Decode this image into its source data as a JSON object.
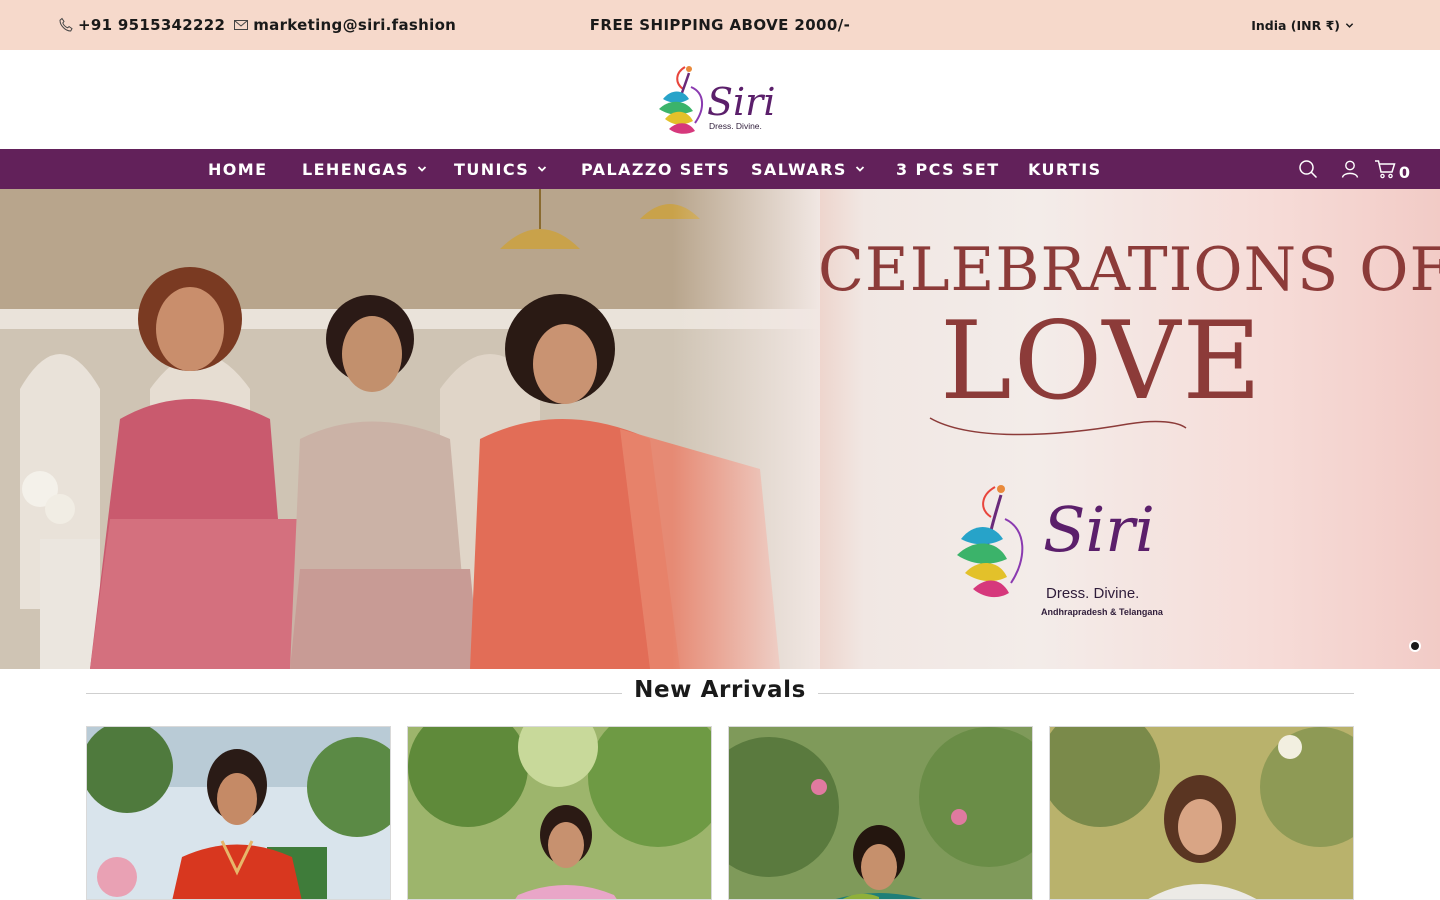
{
  "topbar": {
    "phone": "+91 9515342222",
    "email": "marketing@siri.fashion",
    "promo": "FREE SHIPPING ABOVE 2000/-",
    "currency": "India (INR ₹)"
  },
  "logo": {
    "brand": "Siri",
    "tagline": "Dress. Divine."
  },
  "nav": {
    "items": [
      {
        "label": "HOME",
        "has_dropdown": false
      },
      {
        "label": "LEHENGAS",
        "has_dropdown": true
      },
      {
        "label": "TUNICS",
        "has_dropdown": true
      },
      {
        "label": "PALAZZO SETS",
        "has_dropdown": false
      },
      {
        "label": "SALWARS",
        "has_dropdown": true
      },
      {
        "label": "3 PCS SET",
        "has_dropdown": false
      },
      {
        "label": "KURTIS",
        "has_dropdown": false
      }
    ],
    "cart_count": "0",
    "icons": [
      "search-icon",
      "account-icon",
      "cart-icon"
    ]
  },
  "hero": {
    "headline_line1": "CELEBRATIONS OF",
    "headline_line2": "LOVE",
    "brand": "Siri",
    "tagline": "Dress. Divine.",
    "region": "Andhrapradesh & Telangana",
    "slide_count": 1,
    "active_slide": 1
  },
  "new_arrivals": {
    "title": "New Arrivals",
    "products": [
      {
        "outfit_color": "#d8371f"
      },
      {
        "outfit_color": "#e9a6c8"
      },
      {
        "outfit_color": "#1f7f78"
      },
      {
        "outfit_color": "#eceae6"
      }
    ]
  },
  "colors": {
    "topbar_bg": "#f6d9cb",
    "nav_bg": "#62215a",
    "hero_text": "#8c3b39",
    "brand_purple": "#5b1f6b"
  }
}
